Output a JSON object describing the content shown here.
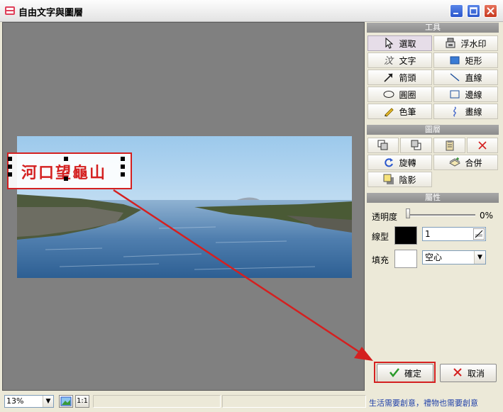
{
  "window": {
    "title": "自由文字與圖層"
  },
  "canvas": {
    "text_object": "河口望龜山"
  },
  "panel": {
    "tools_header": "工具",
    "tools": [
      {
        "label": "選取",
        "icon": "pointer-icon"
      },
      {
        "label": "浮水印",
        "icon": "watermark-icon"
      },
      {
        "label": "文字",
        "icon": "text-tool-icon"
      },
      {
        "label": "矩形",
        "icon": "rectangle-icon"
      },
      {
        "label": "箭頭",
        "icon": "arrow-icon"
      },
      {
        "label": "直線",
        "icon": "line-icon"
      },
      {
        "label": "圓圈",
        "icon": "ellipse-icon"
      },
      {
        "label": "邊線",
        "icon": "border-icon"
      },
      {
        "label": "色筆",
        "icon": "pencil-icon"
      },
      {
        "label": "畫線",
        "icon": "freehand-icon"
      }
    ],
    "layers_header": "圖層",
    "layer_actions": {
      "rotate_label": "旋轉",
      "merge_label": "合併",
      "shadow_label": "陰影"
    },
    "props_header": "屬性",
    "props": {
      "opacity_label": "透明度",
      "opacity_value": "0%",
      "opacity_level": 0,
      "line_label": "線型",
      "line_width": "1",
      "fill_label": "填充",
      "fill_value": "空心"
    }
  },
  "buttons": {
    "ok_label": "確定",
    "cancel_label": "取消"
  },
  "statusbar": {
    "zoom": "13%",
    "one_to_one": "1:1",
    "slogan": "生活需要創意，禮物也需要創意"
  },
  "colors": {
    "accent_red": "#d42020",
    "line_color": "#000000",
    "fill_color": "#ffffff"
  }
}
